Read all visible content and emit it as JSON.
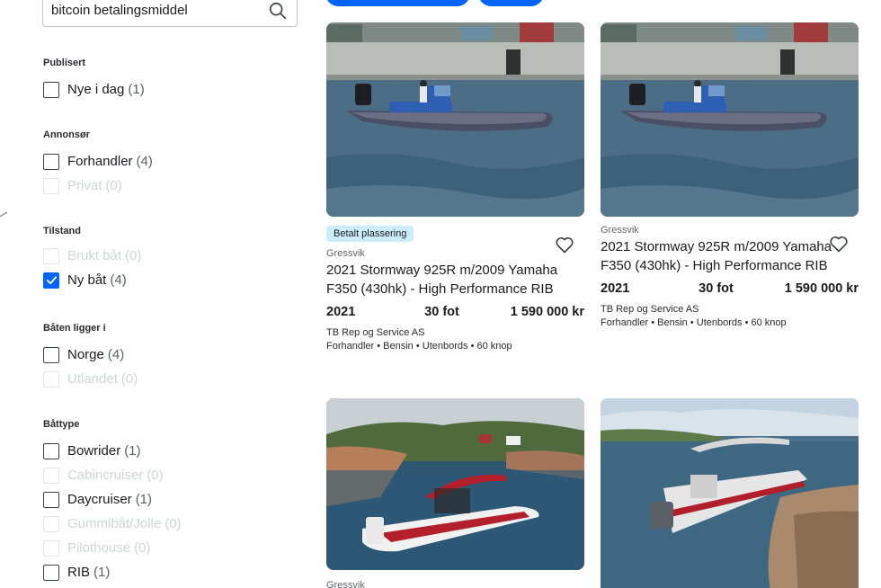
{
  "search": {
    "value": "bitcoin betalingsmiddel"
  },
  "filters": [
    {
      "title": "Publisert",
      "options": [
        {
          "label": "Nye i dag",
          "count": "(1)",
          "state": "unchecked"
        }
      ]
    },
    {
      "title": "Annonsør",
      "options": [
        {
          "label": "Forhandler",
          "count": "(4)",
          "state": "unchecked"
        },
        {
          "label": "Privat",
          "count": "(0)",
          "state": "disabled"
        }
      ]
    },
    {
      "title": "Tilstand",
      "options": [
        {
          "label": "Brukt båt",
          "count": "(0)",
          "state": "disabled"
        },
        {
          "label": "Ny båt",
          "count": "(4)",
          "state": "checked"
        }
      ]
    },
    {
      "title": "Båten ligger i",
      "options": [
        {
          "label": "Norge",
          "count": "(4)",
          "state": "unchecked"
        },
        {
          "label": "Utlandet",
          "count": "(0)",
          "state": "disabled"
        }
      ]
    },
    {
      "title": "Båttype",
      "options": [
        {
          "label": "Bowrider",
          "count": "(1)",
          "state": "unchecked"
        },
        {
          "label": "Cabincruiser",
          "count": "(0)",
          "state": "disabled"
        },
        {
          "label": "Daycruiser",
          "count": "(1)",
          "state": "unchecked"
        },
        {
          "label": "Gummibåt/Jolle",
          "count": "(0)",
          "state": "disabled"
        },
        {
          "label": "Pilothouse",
          "count": "(0)",
          "state": "disabled"
        },
        {
          "label": "RIB",
          "count": "(1)",
          "state": "unchecked"
        }
      ]
    }
  ],
  "listings": [
    {
      "badge": "Betalt plassering",
      "location": "Gressvik",
      "title": "2021 Stormway 925R m/2009 Yamaha F350 (430hk) - High Performance RIB",
      "year": "2021",
      "length": "30 fot",
      "price": "1 590 000 kr",
      "seller": "TB Rep og Service AS",
      "specs": "Forhandler • Bensin • Utenbords • 60 knop"
    },
    {
      "badge": "",
      "location": "Gressvik",
      "title": "2021 Stormway 925R m/2009 Yamaha F350 (430hk) - High Performance RIB",
      "year": "2021",
      "length": "30 fot",
      "price": "1 590 000 kr",
      "seller": "TB Rep og Service AS",
      "specs": "Forhandler • Bensin • Utenbords • 60 knop"
    },
    {
      "location": "Gressvik"
    },
    {
      "location": ""
    }
  ],
  "colors": {
    "accent": "#0063fb",
    "badge_bg": "#ccecfa",
    "text": "#1b1b1f",
    "muted": "#62666c"
  },
  "icons": {
    "search": "search-icon",
    "favorite": "heart-icon",
    "checkbox_checked": "checkmark-icon"
  }
}
